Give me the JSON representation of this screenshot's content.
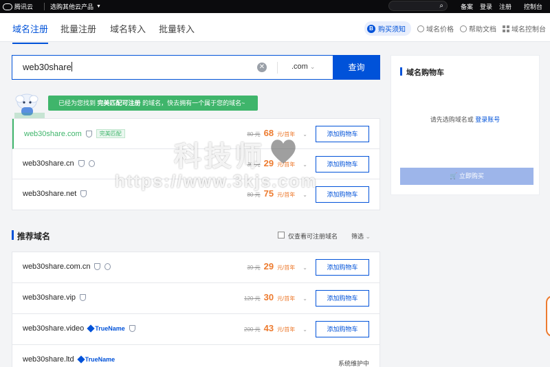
{
  "topbar": {
    "brand": "腾讯云",
    "products": "选购其他云产品",
    "links": [
      "备案",
      "登录",
      "注册"
    ],
    "console": "控制台"
  },
  "tabs": [
    "域名注册",
    "批量注册",
    "域名转入",
    "批量转入"
  ],
  "header_links": {
    "notice": "购买须知",
    "price": "域名价格",
    "docs": "帮助文档",
    "console": "域名控制台"
  },
  "search": {
    "value": "web30share",
    "tld": ".com",
    "query_button": "查询"
  },
  "banner": {
    "prefix": "已经为您找到",
    "highlight": "完美匹配可注册",
    "suffix": "的域名，快去拥有一个属于您的域名~"
  },
  "results": [
    {
      "name": "web30share.com",
      "tag": "完美匹配",
      "old": "80 元",
      "price": "68",
      "unit": "元/首年",
      "button": "添加购物车"
    },
    {
      "name": "web30share.cn",
      "old": "39 元",
      "price": "29",
      "unit": "元/首年",
      "button": "添加购物车"
    },
    {
      "name": "web30share.net",
      "old": "80 元",
      "price": "75",
      "unit": "元/首年",
      "button": "添加购物车"
    }
  ],
  "recommended": {
    "title": "推荐域名",
    "only_available": "仅查看可注册域名",
    "filter": "筛选",
    "items": [
      {
        "name": "web30share.com.cn",
        "old": "39 元",
        "price": "29",
        "unit": "元/首年",
        "button": "添加购物车"
      },
      {
        "name": "web30share.vip",
        "old": "120 元",
        "price": "30",
        "unit": "元/首年",
        "button": "添加购物车"
      },
      {
        "name": "web30share.video",
        "badge": "TrueName",
        "old": "200 元",
        "price": "43",
        "unit": "元/首年",
        "button": "添加购物车"
      },
      {
        "name": "web30share.ltd",
        "badge": "TrueName",
        "status": "系统维护中"
      }
    ]
  },
  "cart": {
    "title": "域名购物车",
    "hint": "请先选购域名或",
    "login": "登录账号",
    "buy": "立即购买"
  },
  "watermark": {
    "text": "科技师",
    "url": "https://www.3kjs.com"
  },
  "colors": {
    "accent": "#0052d9",
    "success": "#3fb56b",
    "price": "#ed7b2f"
  }
}
